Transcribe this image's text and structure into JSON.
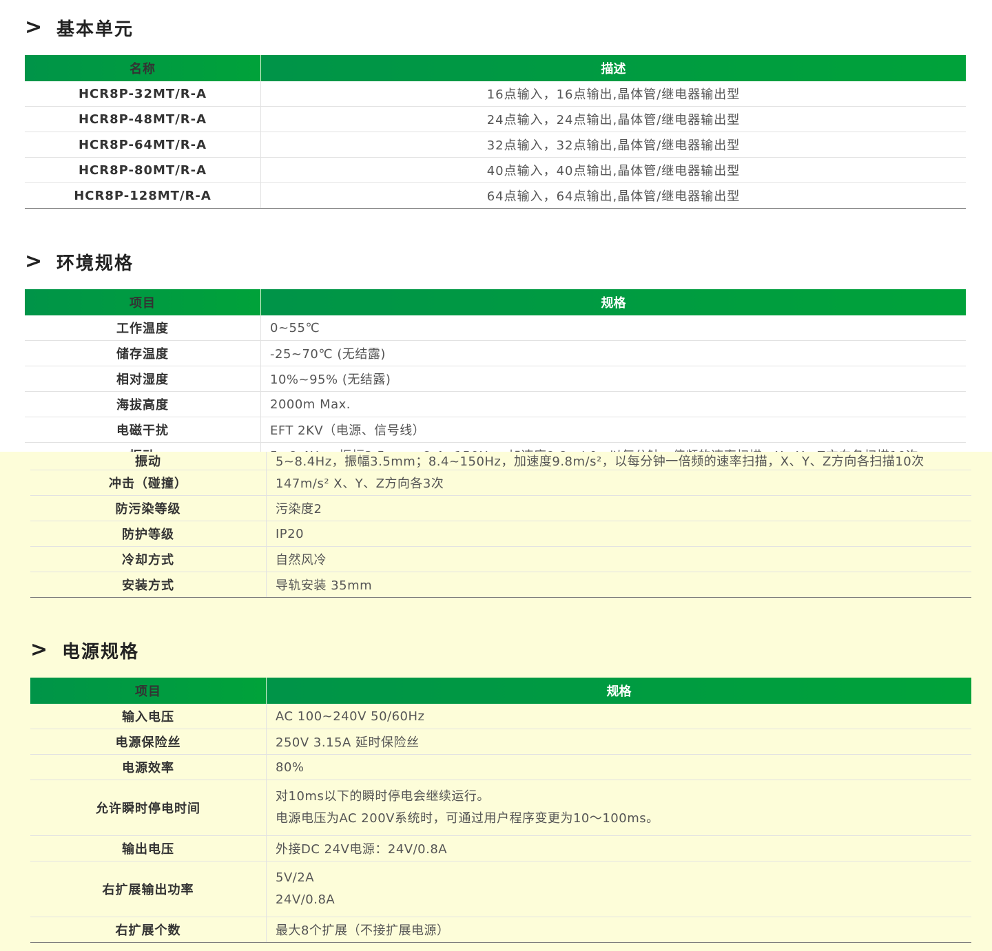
{
  "sections": {
    "basic": {
      "arrow": ">",
      "title": "基本单元",
      "headers": [
        "名称",
        "描述"
      ],
      "rows": [
        {
          "name": "HCR8P-32MT/R-A",
          "desc": "16点输入，16点输出,晶体管/继电器输出型"
        },
        {
          "name": "HCR8P-48MT/R-A",
          "desc": "24点输入，24点输出,晶体管/继电器输出型"
        },
        {
          "name": "HCR8P-64MT/R-A",
          "desc": "32点输入，32点输出,晶体管/继电器输出型"
        },
        {
          "name": "HCR8P-80MT/R-A",
          "desc": "40点输入，40点输出,晶体管/继电器输出型"
        },
        {
          "name": "HCR8P-128MT/R-A",
          "desc": "64点输入，64点输出,晶体管/继电器输出型"
        }
      ]
    },
    "env": {
      "arrow": ">",
      "title": "环境规格",
      "headers": [
        "项目",
        "规格"
      ],
      "rows": [
        {
          "name": "工作温度",
          "spec": "0~55℃"
        },
        {
          "name": "储存温度",
          "spec": "-25~70℃ (无结露)"
        },
        {
          "name": "相对湿度",
          "spec": "10%~95% (无结露)"
        },
        {
          "name": "海拔高度",
          "spec": "2000m Max."
        },
        {
          "name": "电磁干扰",
          "spec": "EFT 2KV（电源、信号线）"
        },
        {
          "name": "振动",
          "spec": "5~8.4Hz，振幅3.5mm；8.4~150Hz，加速度9.8m/s²，以每分钟一倍频的速率扫描，X、Y、Z方向各扫描10次"
        },
        {
          "name": "冲击（碰撞）",
          "spec": "147m/s² X、Y、Z方向各3次"
        },
        {
          "name": "防污染等级",
          "spec": "污染度2"
        },
        {
          "name": "防护等级",
          "spec": "IP20"
        },
        {
          "name": "冷却方式",
          "spec": "自然风冷"
        },
        {
          "name": "安装方式",
          "spec": "导轨安装 35mm"
        }
      ]
    },
    "power": {
      "arrow": ">",
      "title": "电源规格",
      "headers": [
        "项目",
        "规格"
      ],
      "rows": [
        {
          "name": "输入电压",
          "lines": [
            "AC 100~240V 50/60Hz"
          ]
        },
        {
          "name": "电源保险丝",
          "lines": [
            "250V 3.15A 延时保险丝"
          ]
        },
        {
          "name": "电源效率",
          "lines": [
            "80%"
          ]
        },
        {
          "name": "允许瞬时停电时间",
          "lines": [
            "对10ms以下的瞬时停电会继续运行。",
            "电源电压为AC 200V系统时，可通过用户程序变更为10～100ms。"
          ]
        },
        {
          "name": "输出电压",
          "lines": [
            "外接DC 24V电源：24V/0.8A"
          ]
        },
        {
          "name": "右扩展输出功率",
          "lines": [
            "5V/2A",
            "24V/0.8A"
          ]
        },
        {
          "name": "右扩展个数",
          "lines": [
            "最大8个扩展（不接扩展电源）"
          ]
        }
      ]
    }
  }
}
